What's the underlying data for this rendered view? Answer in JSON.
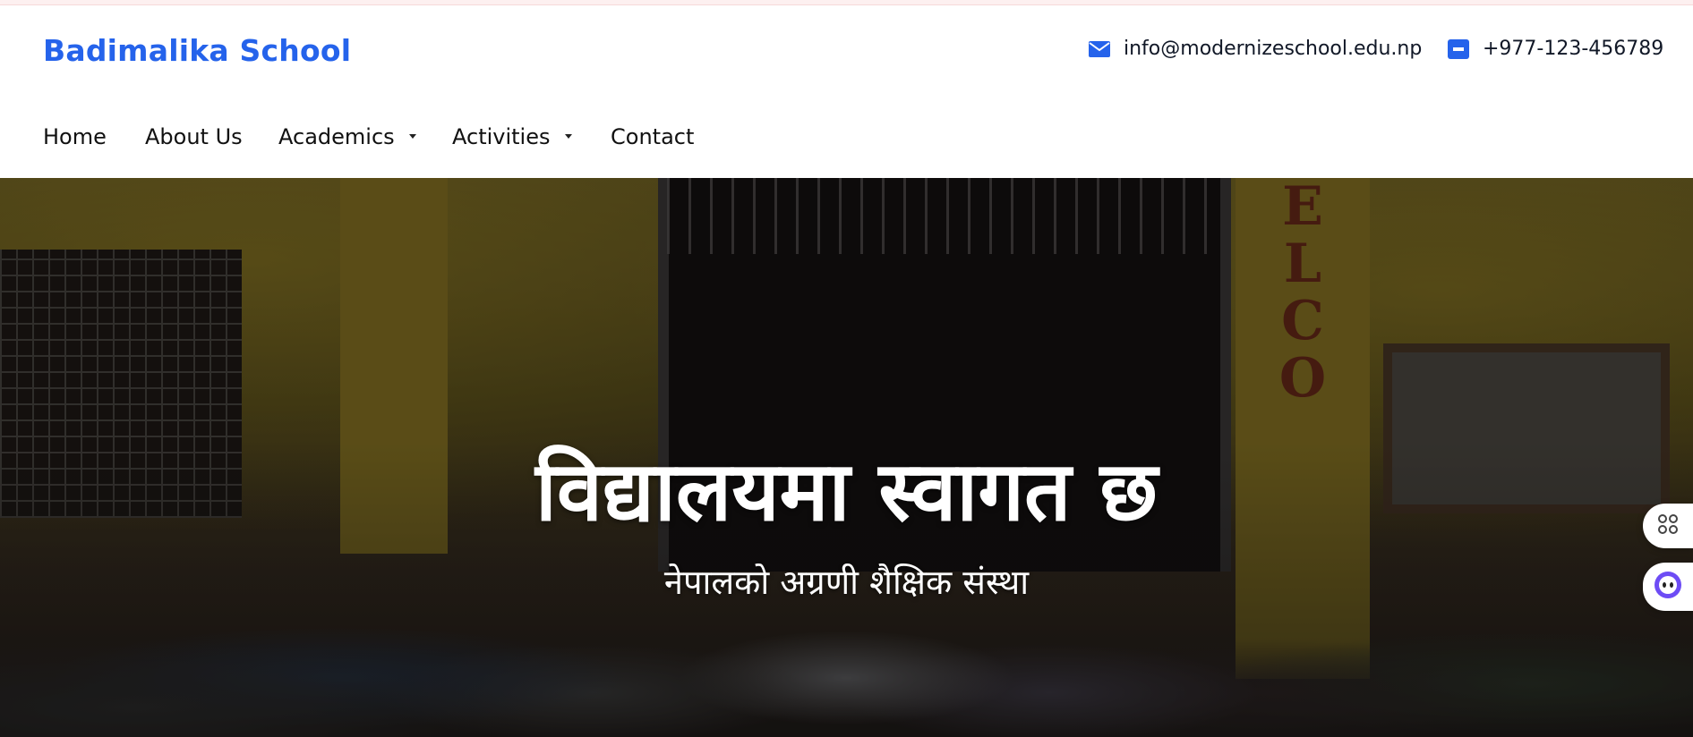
{
  "header": {
    "brand": "Badimalika School",
    "email": "info@modernizeschool.edu.np",
    "phone": "+977-123-456789",
    "email_icon": "envelope-icon",
    "phone_icon": "phone-icon"
  },
  "nav": {
    "items": [
      {
        "label": "Home",
        "dropdown": false
      },
      {
        "label": "About Us",
        "dropdown": false
      },
      {
        "label": "Academics",
        "dropdown": true
      },
      {
        "label": "Activities",
        "dropdown": true
      },
      {
        "label": "Contact",
        "dropdown": false
      }
    ]
  },
  "hero": {
    "title": "विद्यालयमा स्वागत छ",
    "subtitle": "नेपालको अग्रणी शैक्षिक संस्था",
    "banner_letters": [
      "E",
      "L",
      "C",
      "O"
    ]
  },
  "floating": {
    "grid_icon": "grid-icon",
    "assistant_icon": "assistant-icon"
  },
  "colors": {
    "brand": "#2563eb",
    "text": "#111827"
  }
}
